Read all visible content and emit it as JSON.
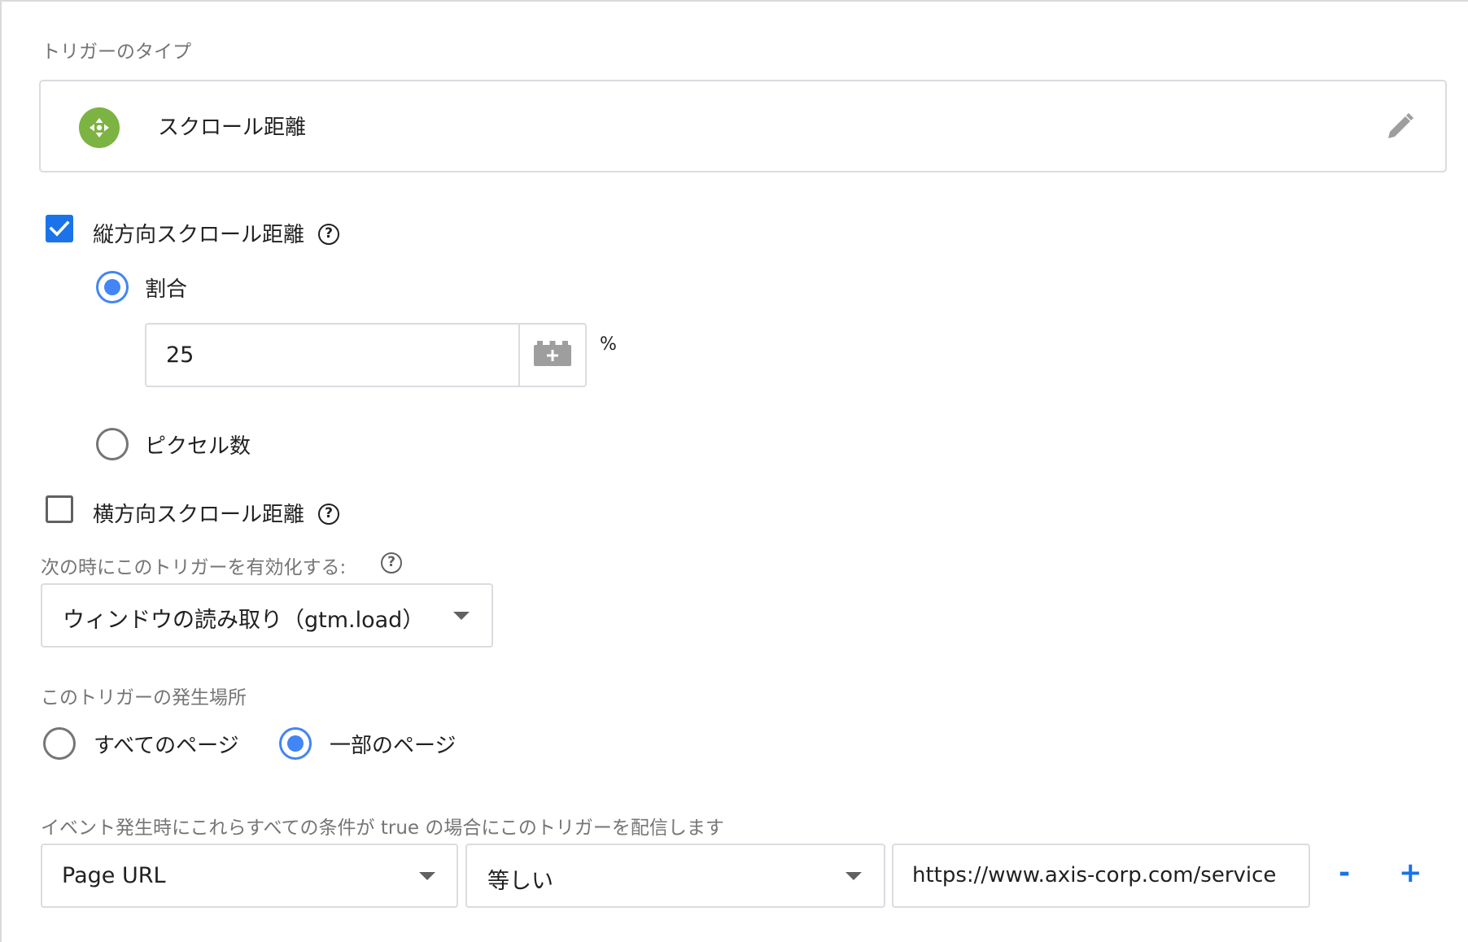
{
  "trigger_type": {
    "section_label": "トリガーのタイプ",
    "name": "スクロール距離",
    "icon": "move-arrows-icon",
    "icon_color": "#7cb342",
    "edit_icon": "pencil-icon"
  },
  "vertical": {
    "label": "縦方向スクロール距離",
    "checked": true,
    "help": "?",
    "percent_option": {
      "label": "割合",
      "selected": true
    },
    "percent_value": "25",
    "percent_unit": "%",
    "pixel_option": {
      "label": "ピクセル数",
      "selected": false
    }
  },
  "horizontal": {
    "label": "横方向スクロール距離",
    "checked": false,
    "help": "?"
  },
  "enable_when": {
    "label": "次の時にこのトリガーを有効化する:",
    "help": "?",
    "selected": "ウィンドウの読み取り（gtm.load）"
  },
  "fire_on": {
    "label": "このトリガーの発生場所",
    "all_pages": {
      "label": "すべてのページ",
      "selected": false
    },
    "some_pages": {
      "label": "一部のページ",
      "selected": true
    }
  },
  "conditions": {
    "label": "イベント発生時にこれらすべての条件が true の場合にこのトリガーを配信します",
    "rows": [
      {
        "variable": "Page URL",
        "operator": "等しい",
        "value": "https://www.axis-corp.com/service"
      }
    ],
    "remove_label": "-",
    "add_label": "+"
  },
  "colors": {
    "accent": "#1a73e8",
    "radio_blue": "#4285f4",
    "icon_green": "#7cb342"
  }
}
